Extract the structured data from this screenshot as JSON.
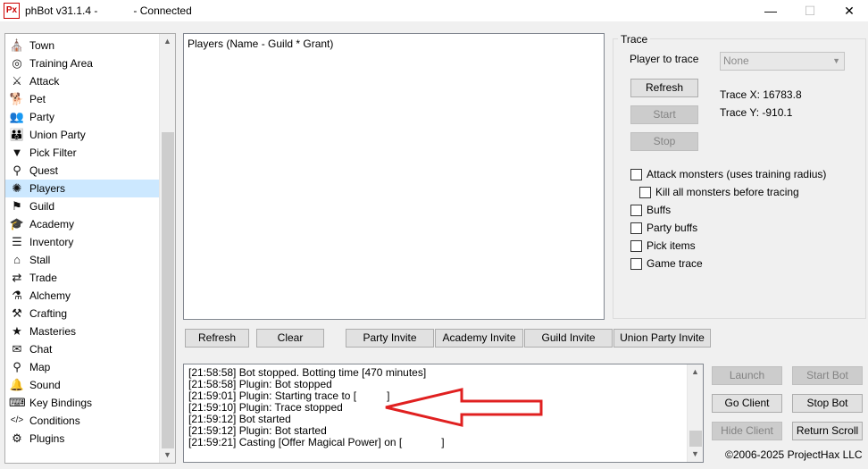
{
  "window": {
    "title": "phBot v31.1.4 -            - Connected",
    "icon_text": "Px",
    "minimize": "—",
    "maximize": "☐",
    "close": "✕"
  },
  "sidebar": {
    "items": [
      {
        "label": "Town",
        "icon": "town-icon",
        "glyph": "⛪"
      },
      {
        "label": "Training Area",
        "icon": "training-area-icon",
        "glyph": "◎"
      },
      {
        "label": "Attack",
        "icon": "attack-icon",
        "glyph": "⚔"
      },
      {
        "label": "Pet",
        "icon": "pet-icon",
        "glyph": "🐕"
      },
      {
        "label": "Party",
        "icon": "party-icon",
        "glyph": "👥"
      },
      {
        "label": "Union Party",
        "icon": "union-party-icon",
        "glyph": "👪"
      },
      {
        "label": "Pick Filter",
        "icon": "filter-icon",
        "glyph": "▼"
      },
      {
        "label": "Quest",
        "icon": "quest-icon",
        "glyph": "⚲"
      },
      {
        "label": "Players",
        "icon": "players-icon",
        "glyph": "✺"
      },
      {
        "label": "Guild",
        "icon": "guild-icon",
        "glyph": "⚑"
      },
      {
        "label": "Academy",
        "icon": "academy-icon",
        "glyph": "🎓"
      },
      {
        "label": "Inventory",
        "icon": "inventory-icon",
        "glyph": "☰"
      },
      {
        "label": "Stall",
        "icon": "stall-icon",
        "glyph": "⌂"
      },
      {
        "label": "Trade",
        "icon": "trade-icon",
        "glyph": "⇄"
      },
      {
        "label": "Alchemy",
        "icon": "alchemy-icon",
        "glyph": "⚗"
      },
      {
        "label": "Crafting",
        "icon": "crafting-icon",
        "glyph": "⚒"
      },
      {
        "label": "Masteries",
        "icon": "masteries-icon",
        "glyph": "★"
      },
      {
        "label": "Chat",
        "icon": "chat-icon",
        "glyph": "✉"
      },
      {
        "label": "Map",
        "icon": "map-pin-icon",
        "glyph": "⚲"
      },
      {
        "label": "Sound",
        "icon": "sound-icon",
        "glyph": "🔔"
      },
      {
        "label": "Key Bindings",
        "icon": "keyboard-icon",
        "glyph": "⌨"
      },
      {
        "label": "Conditions",
        "icon": "code-icon",
        "glyph": "</>"
      },
      {
        "label": "Plugins",
        "icon": "plugins-icon",
        "glyph": "⚙"
      }
    ],
    "selected": "Players"
  },
  "players": {
    "header": "Players (Name - Guild * Grant)"
  },
  "buttons": {
    "refresh": "Refresh",
    "clear": "Clear",
    "party_invite": "Party Invite",
    "academy_invite": "Academy Invite",
    "guild_invite": "Guild Invite",
    "union_party_invite": "Union Party Invite"
  },
  "trace": {
    "group_title": "Trace",
    "player_to_trace_label": "Player to trace",
    "player_value": "None",
    "refresh": "Refresh",
    "start": "Start",
    "stop": "Stop",
    "trace_x": "Trace X:  16783.8",
    "trace_y": "Trace Y:  -910.1",
    "options": {
      "attack_monsters": "Attack monsters (uses training radius)",
      "kill_all": "Kill all monsters before tracing",
      "buffs": "Buffs",
      "party_buffs": "Party buffs",
      "pick_items": "Pick items",
      "game_trace": "Game trace"
    }
  },
  "log": {
    "lines": [
      "[21:58:58] Bot stopped. Botting time [470 minutes]",
      "[21:58:58] Plugin: Bot stopped",
      "[21:59:01] Plugin: Starting trace to [",
      "[21:59:10] Plugin: Trace stopped",
      "[21:59:12] Bot started",
      "[21:59:12] Plugin: Bot started",
      "[21:59:21] Casting [Offer Magical Power] on ["
    ],
    "line_suffixes": [
      "",
      "",
      "]",
      "",
      "",
      "",
      "]"
    ]
  },
  "controls": {
    "launch": "Launch",
    "start_bot": "Start Bot",
    "go_client": "Go Client",
    "stop_bot": "Stop Bot",
    "hide_client": "Hide Client",
    "return_scroll": "Return Scroll"
  },
  "copyright": "©2006-2025 ProjectHax LLC",
  "colors": {
    "annotation_arrow": "#e02020",
    "selected_row": "#cce8ff"
  }
}
